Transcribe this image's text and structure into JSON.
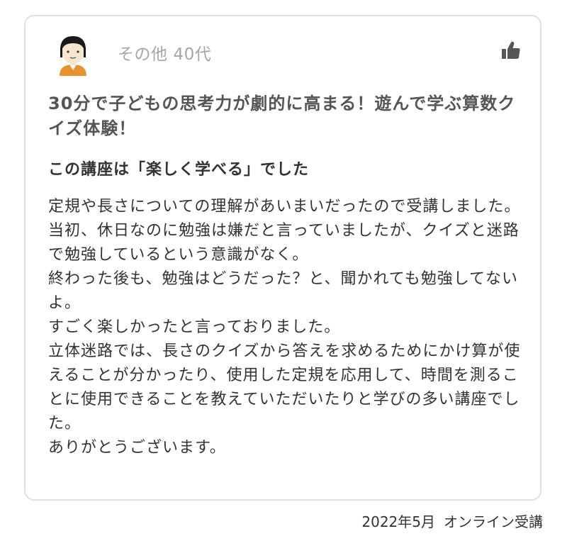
{
  "review": {
    "reviewer": {
      "category": "その他",
      "age": "40代",
      "avatar_icon": "user-avatar-icon"
    },
    "like_icon": "thumbs-up-icon",
    "course_title": "30分で子どもの思考力が劇的に高まる！遊んで学ぶ算数クイズ体験！",
    "headline": "この講座は「楽しく学べる」でした",
    "body_lines": [
      "定規や長さについての理解があいまいだったので受講しました。",
      "当初、休日なのに勉強は嫌だと言っていましたが、クイズと迷路で勉強しているという意識がなく。",
      "終わった後も、勉強はどうだった？と、聞かれても勉強してないよ。",
      "すごく楽しかったと言っておりました。",
      "立体迷路では、長さのクイズから答えを求めるためにかけ算が使えることが分かったり、使用した定規を応用して、時間を測ることに使用できることを教えていただいたりと学びの多い講座でした。",
      "ありがとうございます。"
    ]
  },
  "footer": {
    "date": "2022年5月",
    "format": "オンライン受講"
  },
  "colors": {
    "border": "#e0e0e0",
    "meta_text": "#a6a6a6",
    "title_text": "#555555",
    "body_text": "#333333",
    "avatar_shirt": "#e8912d",
    "avatar_hair": "#1a1a1a",
    "avatar_skin": "#f7e6cf",
    "icon_gray": "#555555"
  }
}
